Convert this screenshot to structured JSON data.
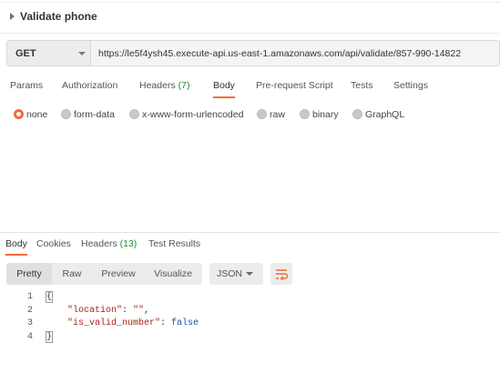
{
  "request": {
    "name": "Validate phone",
    "method": "GET",
    "url": "https://le5f4ysh45.execute-api.us-east-1.amazonaws.com/api/validate/857-990-14822"
  },
  "request_tabs": [
    {
      "label": "Params"
    },
    {
      "label": "Authorization"
    },
    {
      "label": "Headers",
      "count": "(7)"
    },
    {
      "label": "Body",
      "active": true
    },
    {
      "label": "Pre-request Script"
    },
    {
      "label": "Tests"
    },
    {
      "label": "Settings"
    }
  ],
  "body_types": [
    {
      "label": "none",
      "selected": true
    },
    {
      "label": "form-data"
    },
    {
      "label": "x-www-form-urlencoded"
    },
    {
      "label": "raw"
    },
    {
      "label": "binary"
    },
    {
      "label": "GraphQL"
    }
  ],
  "response_tabs": [
    {
      "label": "Body",
      "active": true
    },
    {
      "label": "Cookies"
    },
    {
      "label": "Headers",
      "count": "(13)"
    },
    {
      "label": "Test Results"
    }
  ],
  "view_modes": [
    {
      "label": "Pretty",
      "active": true
    },
    {
      "label": "Raw"
    },
    {
      "label": "Preview"
    },
    {
      "label": "Visualize"
    }
  ],
  "format": "JSON",
  "response_lines": [
    {
      "num": "1",
      "text": "{"
    },
    {
      "num": "2",
      "key": "\"location\"",
      "sep": ": ",
      "value": "\"\"",
      "trail": ","
    },
    {
      "num": "3",
      "key": "\"is_valid_number\"",
      "sep": ": ",
      "value": "false",
      "trail": ""
    },
    {
      "num": "4",
      "text": "}"
    }
  ],
  "colors": {
    "accent": "#f26b3a",
    "count": "#1e8a3b",
    "json_key": "#a3241a",
    "json_bool": "#1a4fa3"
  }
}
